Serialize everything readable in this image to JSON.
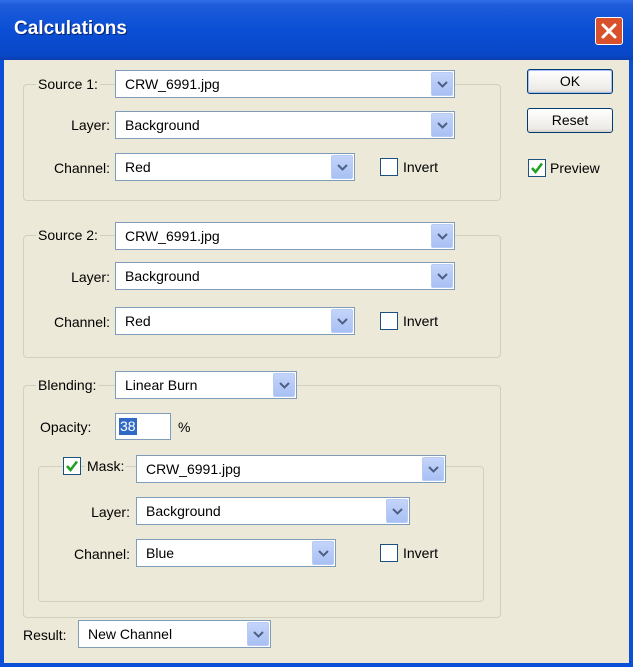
{
  "window": {
    "title": "Calculations"
  },
  "buttons": {
    "ok": "OK",
    "reset": "Reset"
  },
  "preview": {
    "label": "Preview",
    "checked": true
  },
  "source1": {
    "source_label": "Source 1:",
    "source_value": "CRW_6991.jpg",
    "layer_label": "Layer:",
    "layer_value": "Background",
    "channel_label": "Channel:",
    "channel_value": "Red",
    "invert_label": "Invert",
    "invert_checked": false
  },
  "source2": {
    "source_label": "Source 2:",
    "source_value": "CRW_6991.jpg",
    "layer_label": "Layer:",
    "layer_value": "Background",
    "channel_label": "Channel:",
    "channel_value": "Red",
    "invert_label": "Invert",
    "invert_checked": false
  },
  "blending": {
    "blending_label": "Blending:",
    "blending_value": "Linear Burn",
    "opacity_label": "Opacity:",
    "opacity_value": "38",
    "opacity_unit": "%",
    "mask": {
      "mask_label": "Mask:",
      "mask_checked": true,
      "mask_value": "CRW_6991.jpg",
      "layer_label": "Layer:",
      "layer_value": "Background",
      "channel_label": "Channel:",
      "channel_value": "Blue",
      "invert_label": "Invert",
      "invert_checked": false
    }
  },
  "result": {
    "label": "Result:",
    "value": "New Channel"
  },
  "icons": {
    "close": "close-icon",
    "dropdown": "chevron-down-icon",
    "check": "checkmark-icon"
  },
  "colors": {
    "titlebar": "#0A4FD6",
    "dialog_bg": "#ECE9D8",
    "close_button": "#D9502C",
    "selection": "#316AC5"
  }
}
